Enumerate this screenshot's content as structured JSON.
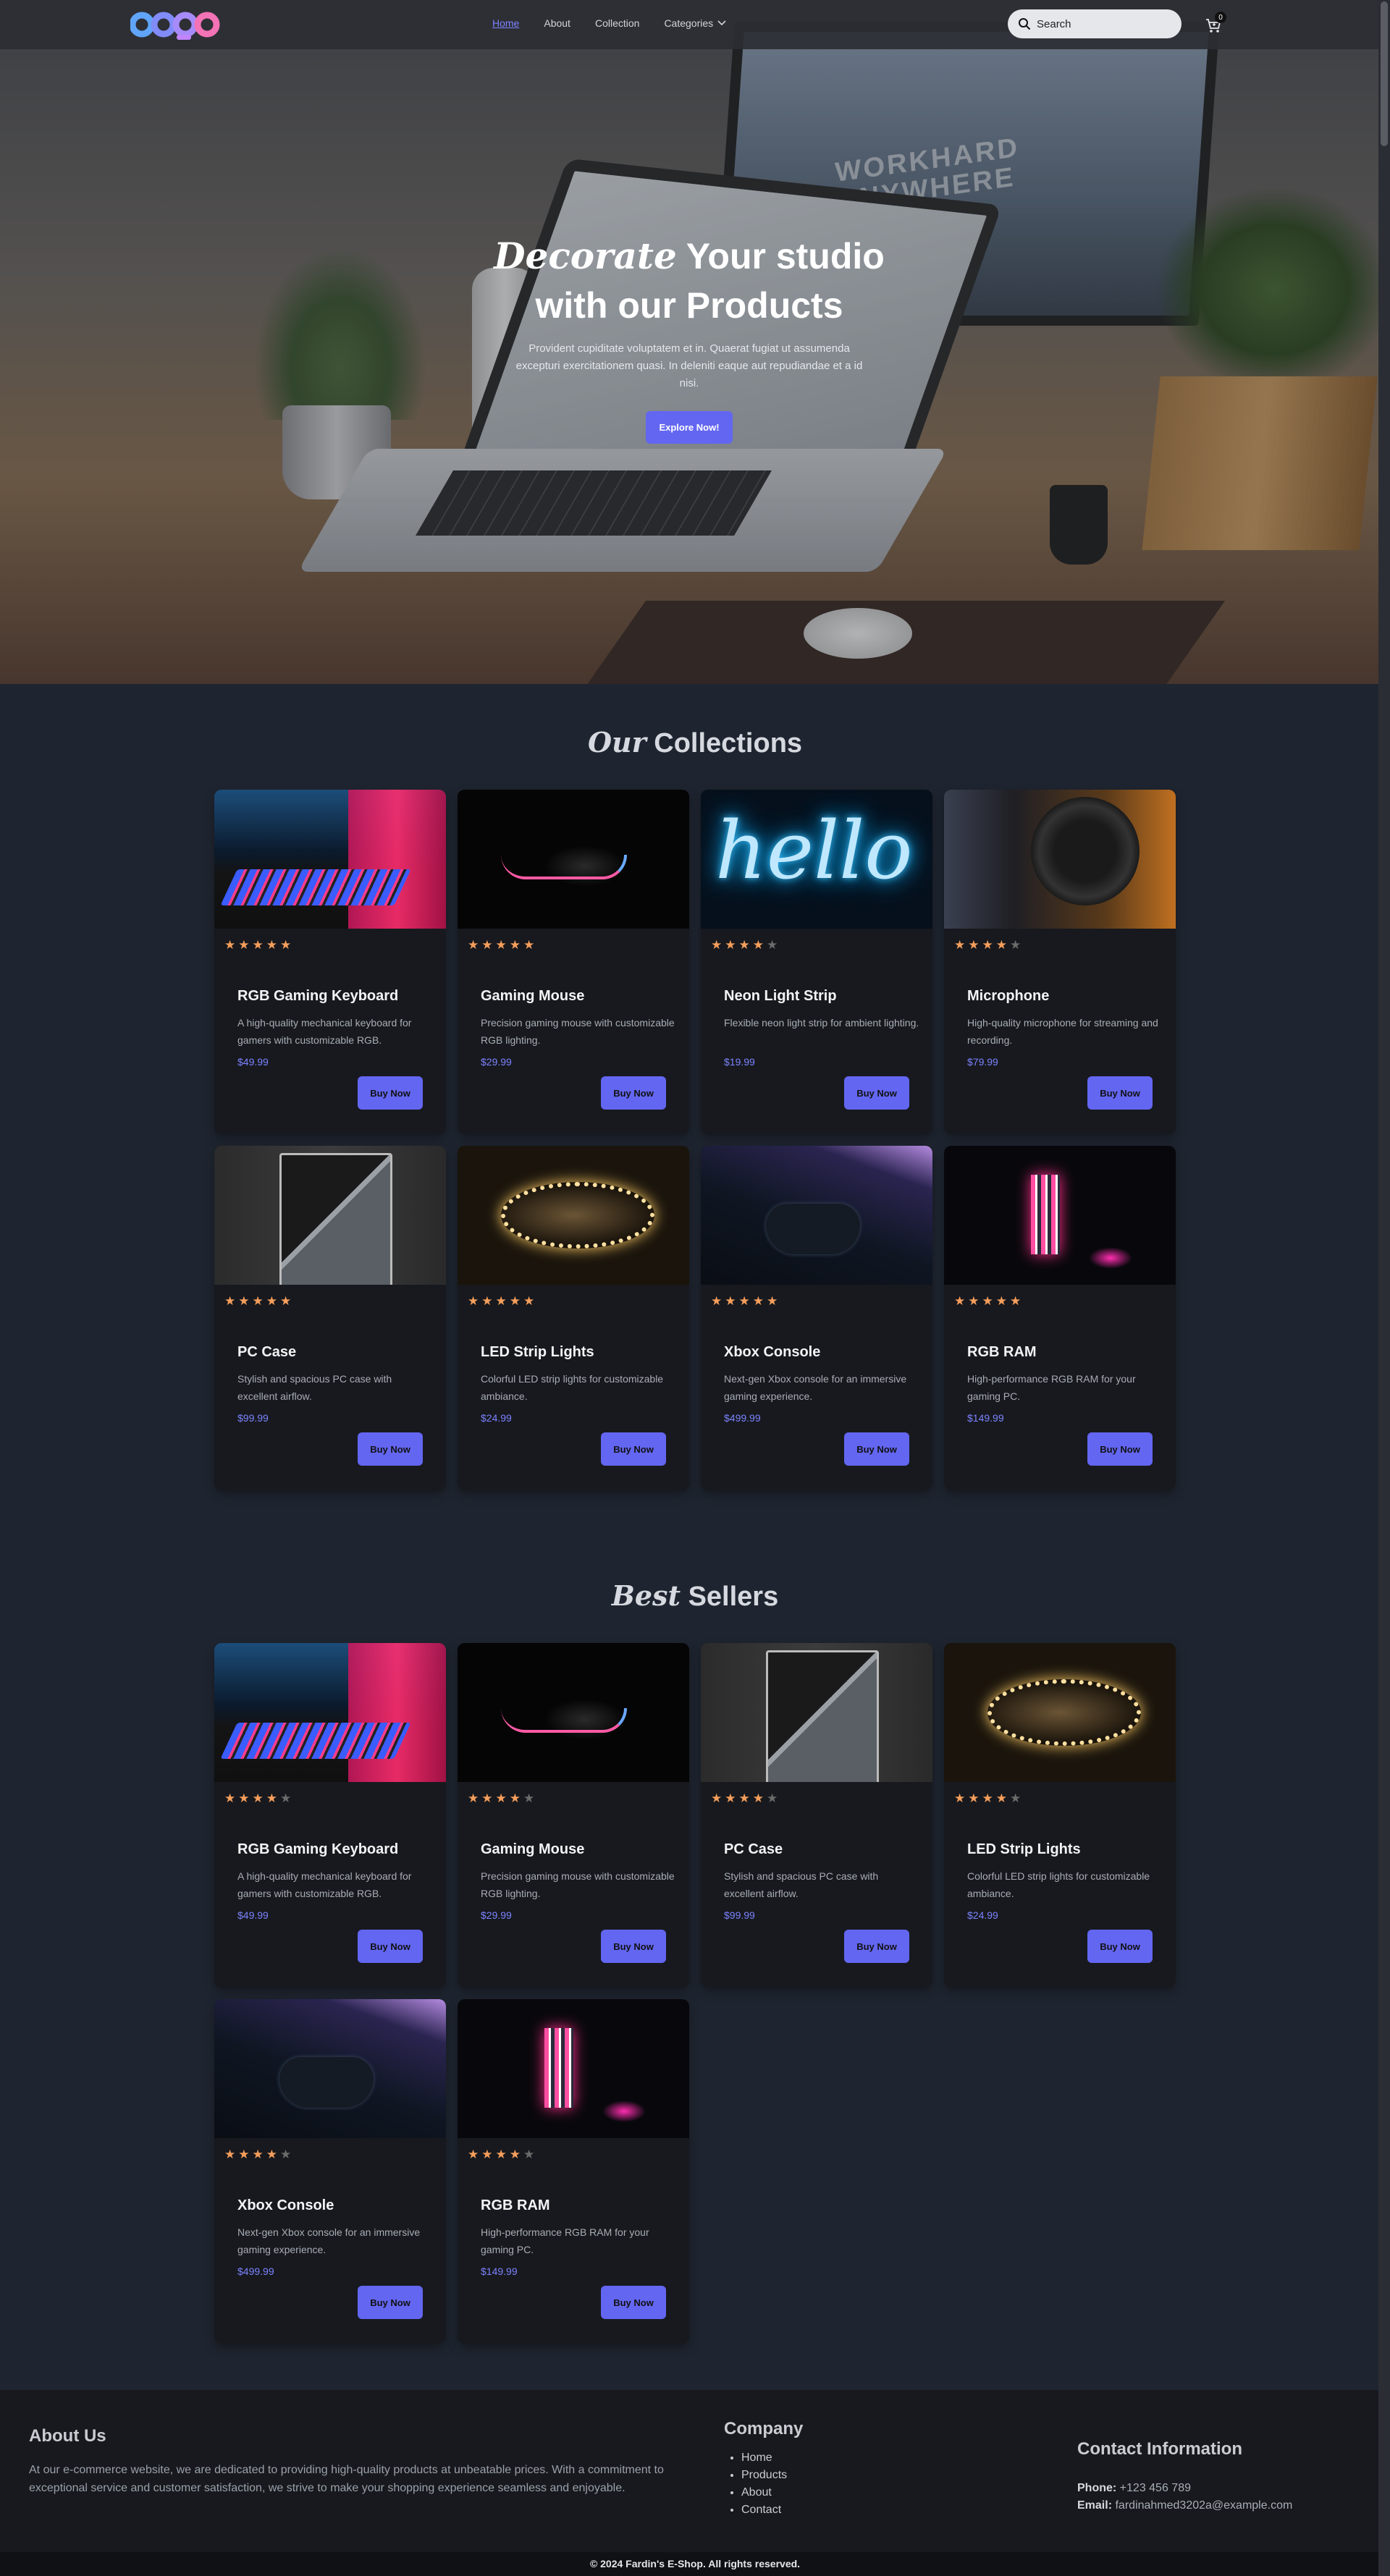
{
  "nav": {
    "logo_alt": "Logo",
    "links": [
      {
        "label": "Home"
      },
      {
        "label": "About"
      },
      {
        "label": "Collection"
      },
      {
        "label": "Categories"
      }
    ],
    "search_placeholder": "Search",
    "cart_count": "0"
  },
  "hero": {
    "title_script": "Decorate",
    "title_rest": " Your studio",
    "title_line2": "with our Products",
    "description": "Provident cupiditate voluptatem et in. Quaerat fugiat ut assumenda excepturi exercitationem quasi. In deleniti eaque aut repudiandae et a id nisi.",
    "button": "Explore Now!",
    "monitor_text": "WORKHARD ANYWHERE"
  },
  "collections": {
    "title_script": "Our",
    "title_rest": " Collections",
    "products": [
      {
        "name": "RGB Gaming Keyboard",
        "desc": "A high-quality mechanical keyboard for gamers with customizable RGB.",
        "price": "$49.99",
        "rating": 5,
        "image": "keyboard",
        "button": "Buy Now"
      },
      {
        "name": "Gaming Mouse",
        "desc": "Precision gaming mouse with customizable RGB lighting.",
        "price": "$29.99",
        "rating": 5,
        "image": "mouse",
        "button": "Buy Now"
      },
      {
        "name": "Neon Light Strip",
        "desc": "Flexible neon light strip for ambient lighting.",
        "price": "$19.99",
        "rating": 4,
        "image": "neon",
        "button": "Buy Now"
      },
      {
        "name": "Microphone",
        "desc": "High-quality microphone for streaming and recording.",
        "price": "$79.99",
        "rating": 4,
        "image": "mic",
        "button": "Buy Now"
      },
      {
        "name": "PC Case",
        "desc": "Stylish and spacious PC case with excellent airflow.",
        "price": "$99.99",
        "rating": 5,
        "image": "pc",
        "button": "Buy Now"
      },
      {
        "name": "LED Strip Lights",
        "desc": "Colorful LED strip lights for customizable ambiance.",
        "price": "$24.99",
        "rating": 5,
        "image": "led",
        "button": "Buy Now"
      },
      {
        "name": "Xbox Console",
        "desc": "Next-gen Xbox console for an immersive gaming experience.",
        "price": "$499.99",
        "rating": 5,
        "image": "xbox",
        "button": "Buy Now"
      },
      {
        "name": "RGB RAM",
        "desc": "High-performance RGB RAM for your gaming PC.",
        "price": "$149.99",
        "rating": 5,
        "image": "ram",
        "button": "Buy Now"
      }
    ]
  },
  "bestsellers": {
    "title_script": "Best",
    "title_rest": " Sellers",
    "products": [
      {
        "name": "RGB Gaming Keyboard",
        "desc": "A high-quality mechanical keyboard for gamers with customizable RGB.",
        "price": "$49.99",
        "rating": 4,
        "image": "keyboard",
        "button": "Buy Now"
      },
      {
        "name": "Gaming Mouse",
        "desc": "Precision gaming mouse with customizable RGB lighting.",
        "price": "$29.99",
        "rating": 4,
        "image": "mouse",
        "button": "Buy Now"
      },
      {
        "name": "PC Case",
        "desc": "Stylish and spacious PC case with excellent airflow.",
        "price": "$99.99",
        "rating": 4,
        "image": "pc",
        "button": "Buy Now"
      },
      {
        "name": "LED Strip Lights",
        "desc": "Colorful LED strip lights for customizable ambiance.",
        "price": "$24.99",
        "rating": 4,
        "image": "led",
        "button": "Buy Now"
      },
      {
        "name": "Xbox Console",
        "desc": "Next-gen Xbox console for an immersive gaming experience.",
        "price": "$499.99",
        "rating": 4,
        "image": "xbox",
        "button": "Buy Now"
      },
      {
        "name": "RGB RAM",
        "desc": "High-performance RGB RAM for your gaming PC.",
        "price": "$149.99",
        "rating": 4,
        "image": "ram",
        "button": "Buy Now"
      }
    ]
  },
  "footer": {
    "about_title": "About Us",
    "about_text": "At our e-commerce website, we are dedicated to providing high-quality products at unbeatable prices. With a commitment to exceptional service and customer satisfaction, we strive to make your shopping experience seamless and enjoyable.",
    "company_title": "Company",
    "company_links": [
      "Home",
      "Products",
      "About",
      "Contact"
    ],
    "contact_title": "Contact Information",
    "phone_label": "Phone:",
    "phone": "+123 456 789",
    "email_label": "Email:",
    "email": "fardinahmed3202a@example.com",
    "copyright": "© 2024 Fardin's E-Shop. All rights reserved."
  },
  "colors": {
    "accent": "#6366f1",
    "link_active": "#7c83ff",
    "star": "#f59e5b",
    "page_bg": "#1f2530",
    "card_bg": "#17191e"
  }
}
